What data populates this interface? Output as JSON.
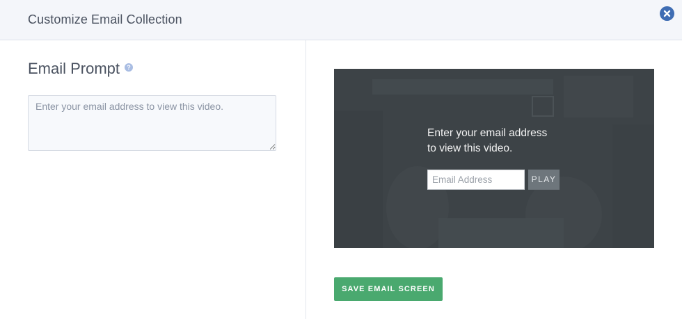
{
  "header": {
    "title": "Customize Email Collection",
    "close_icon": "close-icon"
  },
  "email_prompt": {
    "heading": "Email Prompt",
    "help_icon": "help-icon",
    "textarea_placeholder": "Enter your email address to view this video.",
    "textarea_value": ""
  },
  "preview": {
    "prompt_line1": "Enter your email address",
    "prompt_line2": "to view this video.",
    "email_placeholder": "Email Address",
    "play_label": "PLAY"
  },
  "footer": {
    "save_label": "SAVE EMAIL SCREEN"
  },
  "colors": {
    "header_bg": "#f4f6fa",
    "close_button": "#3f6db3",
    "help_icon": "#a9bde3",
    "preview_bg": "#3d4347",
    "play_button": "#6e767c",
    "save_button": "#4aa96f"
  }
}
